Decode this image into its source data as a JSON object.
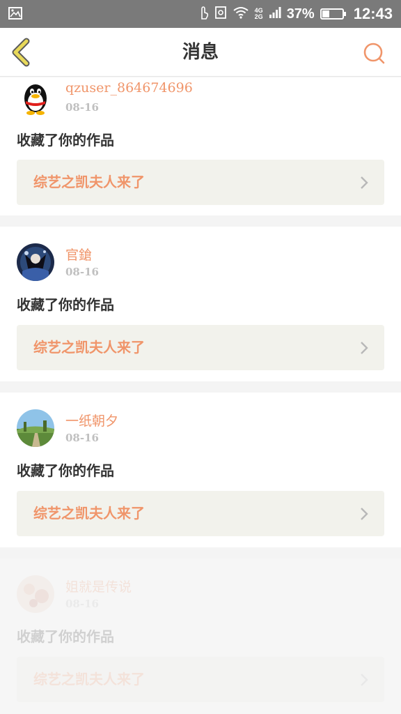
{
  "status_bar": {
    "network": "4G",
    "network2": "2G",
    "battery_percent": "37%",
    "battery_level": 0.37,
    "time": "12:43",
    "icons": [
      "image-icon",
      "touch-icon",
      "screenshot-icon",
      "wifi-icon",
      "signal-icon",
      "battery-icon"
    ]
  },
  "header": {
    "title": "消息",
    "back_icon": "chevron-left-icon",
    "search_icon": "search-icon",
    "accent_color": "#f0956a"
  },
  "messages": [
    {
      "username": "qzuser_864674696",
      "date": "08-16",
      "action": "收藏了你的作品",
      "work_title": "综艺之凯夫人来了",
      "avatar": "qq-penguin-avatar"
    },
    {
      "username": "官鎗",
      "date": "08-16",
      "action": "收藏了你的作品",
      "work_title": "综艺之凯夫人来了",
      "avatar": "anime-avatar"
    },
    {
      "username": "一纸朝夕",
      "date": "08-16",
      "action": "收藏了你的作品",
      "work_title": "综艺之凯夫人来了",
      "avatar": "landscape-avatar"
    },
    {
      "username": "姐就是传说",
      "date": "08-16",
      "action": "收藏了你的作品",
      "work_title": "综艺之凯夫人来了",
      "avatar": "floral-avatar"
    }
  ]
}
